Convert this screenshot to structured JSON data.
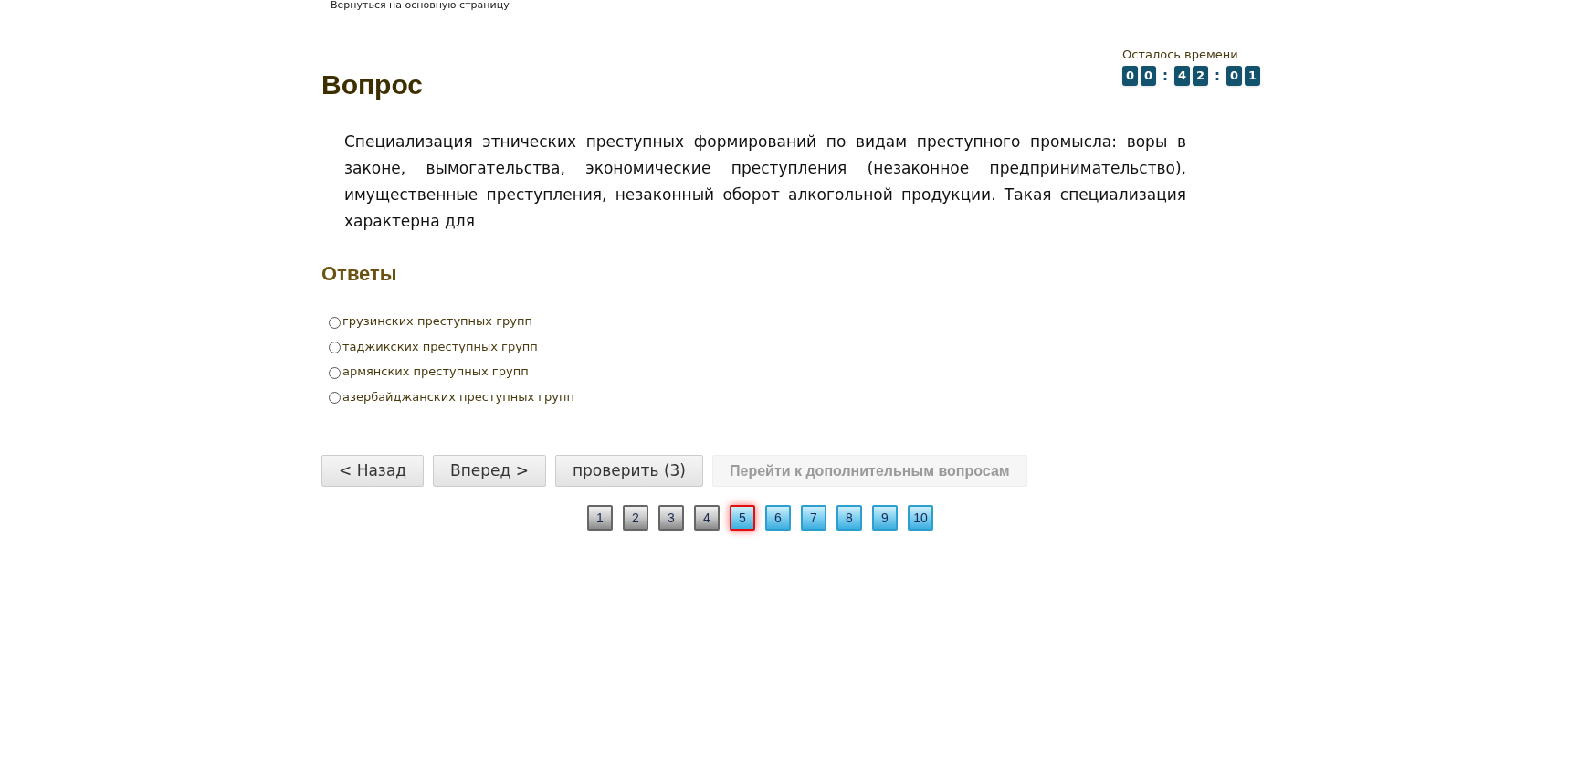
{
  "back_link": "Вернуться на основную страницу",
  "timer": {
    "label": "Осталось времени",
    "cells": [
      {
        "kind": "digit",
        "text": "0"
      },
      {
        "kind": "digit",
        "text": "0"
      },
      {
        "kind": "separator",
        "text": ":"
      },
      {
        "kind": "digit",
        "text": "4"
      },
      {
        "kind": "digit",
        "text": "2"
      },
      {
        "kind": "separator",
        "text": ":"
      },
      {
        "kind": "digit",
        "text": "0"
      },
      {
        "kind": "digit",
        "text": "1"
      }
    ]
  },
  "title": "Вопрос",
  "question": "Специализация этнических преступных формирований по видам преступного промысла: воры в законе, вымогательства, экономические преступления (незаконное предпринимательство), имущественные преступления, незаконный оборот алкогольной продукции. Такая специализация характерна для",
  "answers_title": "Ответы",
  "answers": [
    {
      "label": "грузинских преступных групп",
      "selected": false
    },
    {
      "label": "таджикских преступных групп",
      "selected": false
    },
    {
      "label": "армянских преступных групп",
      "selected": false
    },
    {
      "label": "азербайджанских преступных групп",
      "selected": false
    }
  ],
  "buttons": [
    {
      "label": "< Назад",
      "disabled": false
    },
    {
      "label": "Вперед >",
      "disabled": false
    },
    {
      "label": "проверить (3)",
      "disabled": false
    },
    {
      "label": "Перейти к дополнительным вопросам",
      "disabled": true
    }
  ],
  "pages": [
    {
      "label": "1",
      "visited": true,
      "selected": false
    },
    {
      "label": "2",
      "visited": true,
      "selected": false
    },
    {
      "label": "3",
      "visited": true,
      "selected": false
    },
    {
      "label": "4",
      "visited": true,
      "selected": false
    },
    {
      "label": "5",
      "visited": false,
      "selected": true
    },
    {
      "label": "6",
      "visited": false,
      "selected": false
    },
    {
      "label": "7",
      "visited": false,
      "selected": false
    },
    {
      "label": "8",
      "visited": false,
      "selected": false
    },
    {
      "label": "9",
      "visited": false,
      "selected": false
    },
    {
      "label": "10",
      "visited": false,
      "selected": false
    }
  ]
}
